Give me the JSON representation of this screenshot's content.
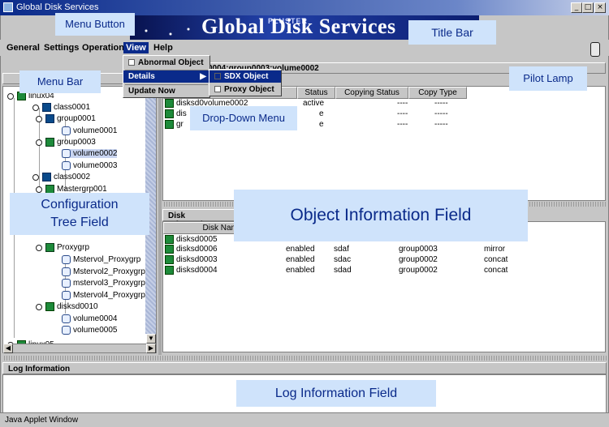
{
  "window": {
    "title": "Global Disk Services",
    "banner_small": "PLUSTER",
    "banner_title": "Global Disk Services",
    "minimize": "_",
    "maximize": "□",
    "close": "×"
  },
  "menubar": {
    "items": [
      "General",
      "Settings",
      "Operation",
      "View",
      "Help"
    ],
    "active": "View"
  },
  "view_menu": {
    "items": [
      {
        "label": "Abnormal Object",
        "checkbox": true,
        "checked": false
      },
      {
        "label": "Details",
        "submenu": true,
        "highlighted": true
      },
      {
        "label": "Update Now"
      }
    ],
    "details_submenu": [
      {
        "label": "SDX Object",
        "checked": true
      },
      {
        "label": "Proxy Object",
        "checked": false
      }
    ]
  },
  "object_header": "0004:group0003:volume0002",
  "tree": {
    "nodes": [
      {
        "label": "linux04",
        "type": "host",
        "level": 0
      },
      {
        "label": "class0001",
        "type": "class",
        "level": 1
      },
      {
        "label": "group0001",
        "type": "group",
        "level": 2
      },
      {
        "label": "volume0001",
        "type": "volume",
        "level": 3
      },
      {
        "label": "group0003",
        "type": "group",
        "level": 2
      },
      {
        "label": "volume0002",
        "type": "volume",
        "level": 3,
        "selected": true
      },
      {
        "label": "volume0003",
        "type": "volume",
        "level": 3
      },
      {
        "label": "class0002",
        "type": "class",
        "level": 1
      },
      {
        "label": "Mastergrp001",
        "type": "group",
        "level": 2
      },
      {
        "label": "Proxygrp",
        "type": "group",
        "level": 2
      },
      {
        "label": "Mstervol_Proxygrp",
        "type": "volume",
        "level": 3
      },
      {
        "label": "Mstervol2_Proxygrp",
        "type": "volume",
        "level": 3
      },
      {
        "label": "mstervol3_Proxygrp",
        "type": "volume",
        "level": 3
      },
      {
        "label": "Mstervol4_Proxygrp",
        "type": "volume",
        "level": 3
      },
      {
        "label": "disksd0010",
        "type": "disk",
        "level": 2
      },
      {
        "label": "volume0004",
        "type": "volume",
        "level": 3
      },
      {
        "label": "volume0005",
        "type": "volume",
        "level": 3
      },
      {
        "label": "linux05",
        "type": "host",
        "level": 0
      }
    ]
  },
  "object_table": {
    "columns": [
      "Status",
      "Copying Status",
      "Copy Type"
    ],
    "rows": [
      {
        "name": "disksd0",
        "volume": "volume0002",
        "status": "active",
        "copying": "----",
        "copytype": "-----"
      },
      {
        "name": "dis",
        "volume": "",
        "status": "e",
        "copying": "----",
        "copytype": "-----"
      },
      {
        "name": "gr",
        "volume": "",
        "status": "e",
        "copying": "----",
        "copytype": "-----"
      }
    ]
  },
  "disk_info": {
    "header": "Disk Information",
    "column_disk_name": "Disk Name",
    "rows": [
      {
        "name": "disksd0005",
        "status": "",
        "device": "",
        "group": "",
        "type": ""
      },
      {
        "name": "disksd0006",
        "status": "enabled",
        "device": "sdaf",
        "group": "group0003",
        "type": "mirror"
      },
      {
        "name": "disksd0003",
        "status": "enabled",
        "device": "sdac",
        "group": "group0002",
        "type": "concat"
      },
      {
        "name": "disksd0004",
        "status": "enabled",
        "device": "sdad",
        "group": "group0002",
        "type": "concat"
      }
    ]
  },
  "log": {
    "header": "Log Information"
  },
  "statusbar": {
    "text": "Java Applet Window"
  },
  "callouts": {
    "menu_button": "Menu Button",
    "title_bar": "Title Bar",
    "menu_bar": "Menu Bar",
    "pilot_lamp": "Pilot Lamp",
    "dropdown_menu": "Drop-Down Menu",
    "config_tree": "Configuration Tree Field",
    "object_info": "Object Information Field",
    "log_info": "Log Information Field"
  }
}
